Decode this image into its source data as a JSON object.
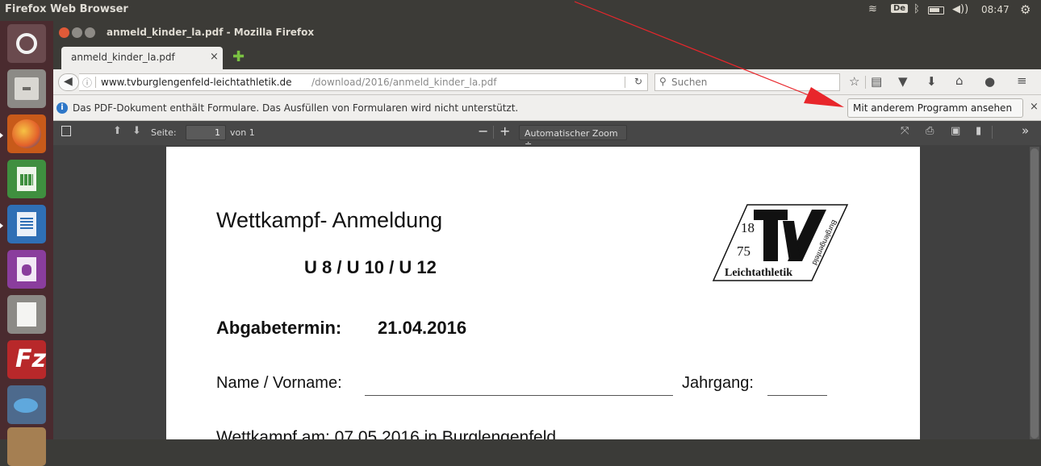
{
  "topbar": {
    "title": "Firefox Web Browser",
    "keyboard_layout": "De",
    "clock": "08:47"
  },
  "window": {
    "title": "anmeld_kinder_la.pdf - Mozilla Firefox"
  },
  "tab": {
    "label": "anmeld_kinder_la.pdf",
    "close": "×"
  },
  "nav": {
    "url_host": "www.tvburglengenfeld-leichtathletik.de",
    "url_path": "/download/2016/anmeld_kinder_la.pdf",
    "search_placeholder": "Suchen"
  },
  "infobar": {
    "message": "Das PDF-Dokument enthält Formulare. Das Ausfüllen von Formularen wird nicht unterstützt.",
    "button_label": "Mit anderem Programm ansehen",
    "close": "×"
  },
  "pdf_toolbar": {
    "page_label": "Seite:",
    "page_value": "1",
    "page_of": "von 1",
    "zoom_minus": "−",
    "zoom_plus": "+",
    "zoom_value": "Automatischer Zoom ÷"
  },
  "document": {
    "heading": "Wettkampf- Anmeldung",
    "subheading": "U 8 / U 10 / U 12",
    "deadline_label": "Abgabetermin:",
    "deadline_value": "21.04.2016",
    "name_label": "Name / Vorname:",
    "year_label": "Jahrgang:",
    "competition_line": "Wettkampf am: 07.05.2016 in Burglengenfeld",
    "logo": {
      "year_top": "18",
      "year_bottom": "75",
      "letters": "TV",
      "side_text": "Burglengenfeld",
      "bottom_text": "Leichtathletik"
    }
  },
  "colors": {
    "ubuntu_panel": "#3c3b37",
    "launcher": "#4a2b2f",
    "annotation_arrow": "#e8262b",
    "pdf_background": "#404040"
  }
}
